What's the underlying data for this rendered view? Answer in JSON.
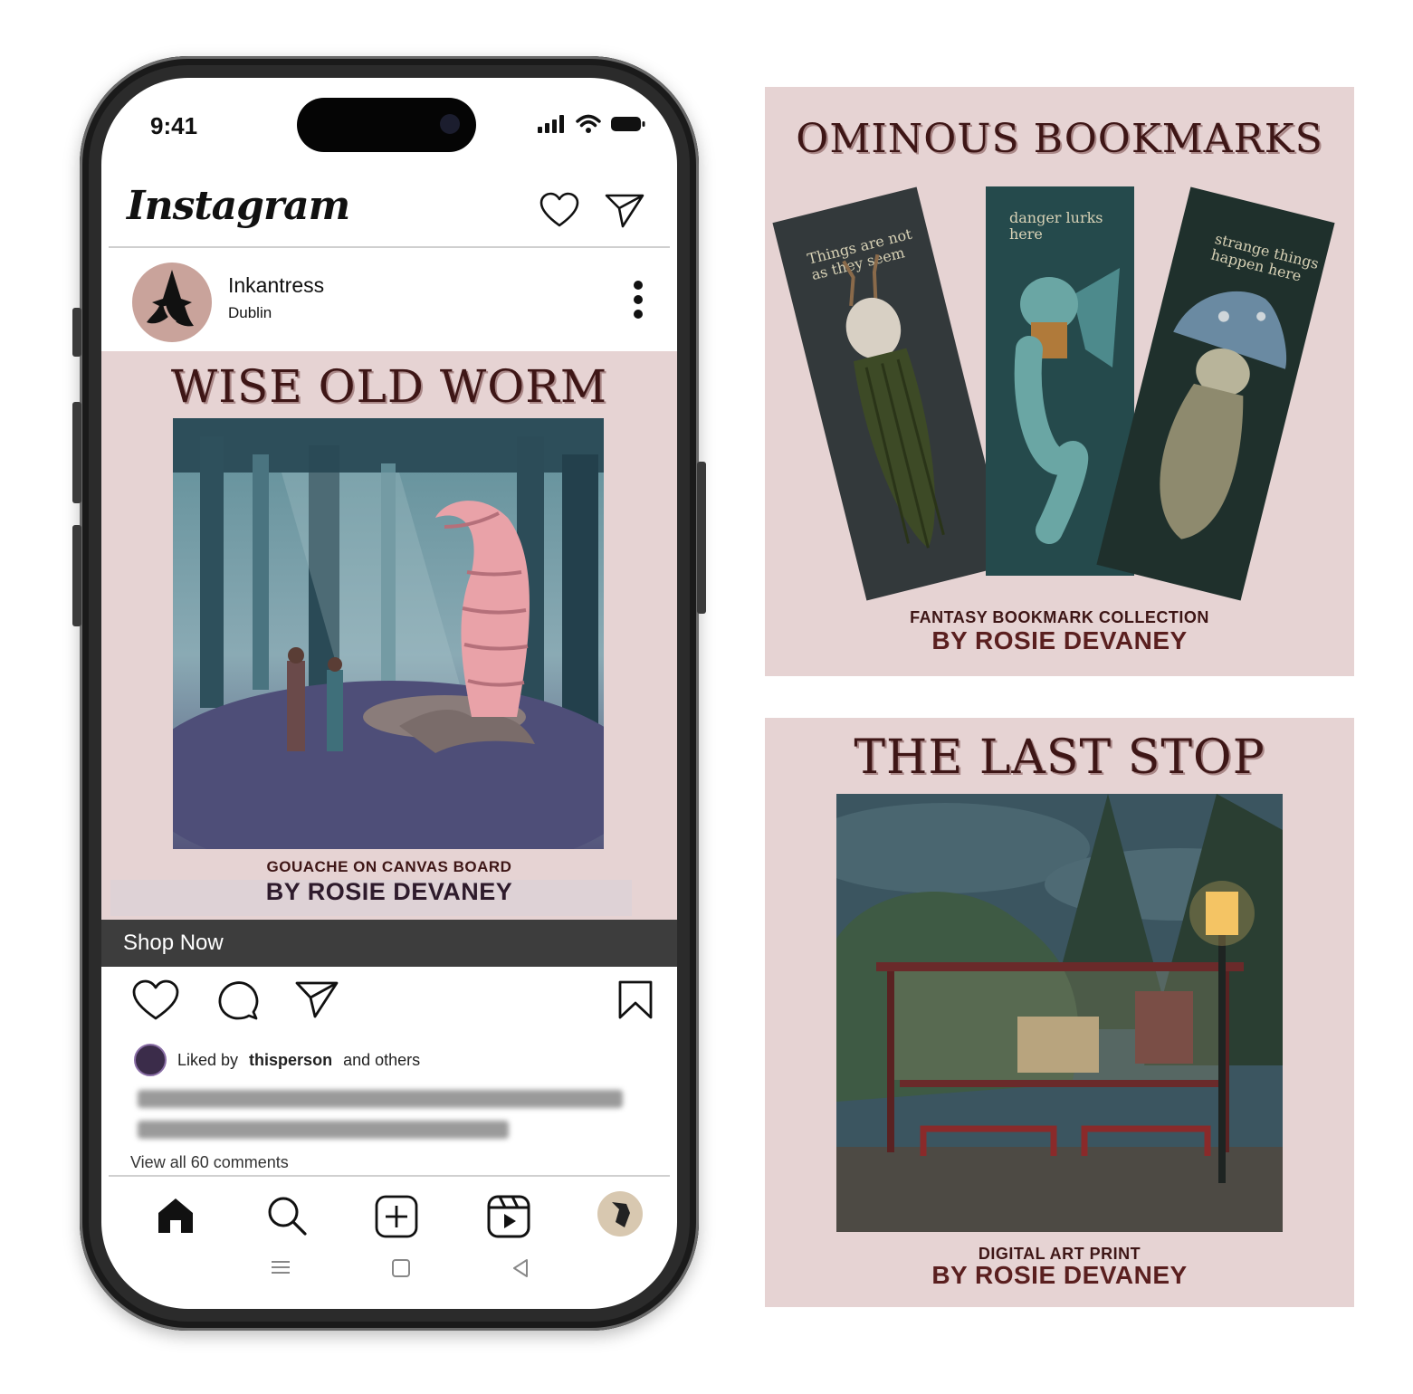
{
  "status_bar": {
    "time": "9:41"
  },
  "app": {
    "name": "Instagram"
  },
  "post": {
    "username": "Inkantress",
    "location": "Dublin",
    "title": "WISE OLD WORM",
    "medium": "GOUACHE ON CANVAS BOARD",
    "artist": "BY ROSIE DEVANEY",
    "cta": "Shop Now",
    "liked_prefix": "Liked by",
    "liked_user": "thisperson",
    "liked_suffix": "and others",
    "view_comments": "View all 60 comments"
  },
  "cards": [
    {
      "title": "OMINOUS BOOKMARKS",
      "subtitle": "FANTASY BOOKMARK COLLECTION",
      "artist": "BY ROSIE DEVANEY",
      "bookmarks": [
        {
          "text": "Things are not as they seem"
        },
        {
          "text": "danger lurks here"
        },
        {
          "text": "strange things happen here"
        }
      ]
    },
    {
      "title": "THE LAST STOP",
      "subtitle": "DIGITAL ART PRINT",
      "artist": "BY ROSIE DEVANEY"
    }
  ],
  "icons": {
    "header": [
      "heart-icon",
      "send-icon"
    ],
    "actions": [
      "heart-icon",
      "comment-icon",
      "send-icon",
      "bookmark-icon"
    ],
    "tabs": [
      "home-icon",
      "search-icon",
      "add-icon",
      "reels-icon",
      "profile-avatar"
    ],
    "system_nav": [
      "menu-icon",
      "home-square-icon",
      "back-icon"
    ]
  },
  "colors": {
    "card_bg": "#e6d3d3",
    "title_text": "#3e1616",
    "shop_bar": "#3d3d3d"
  }
}
